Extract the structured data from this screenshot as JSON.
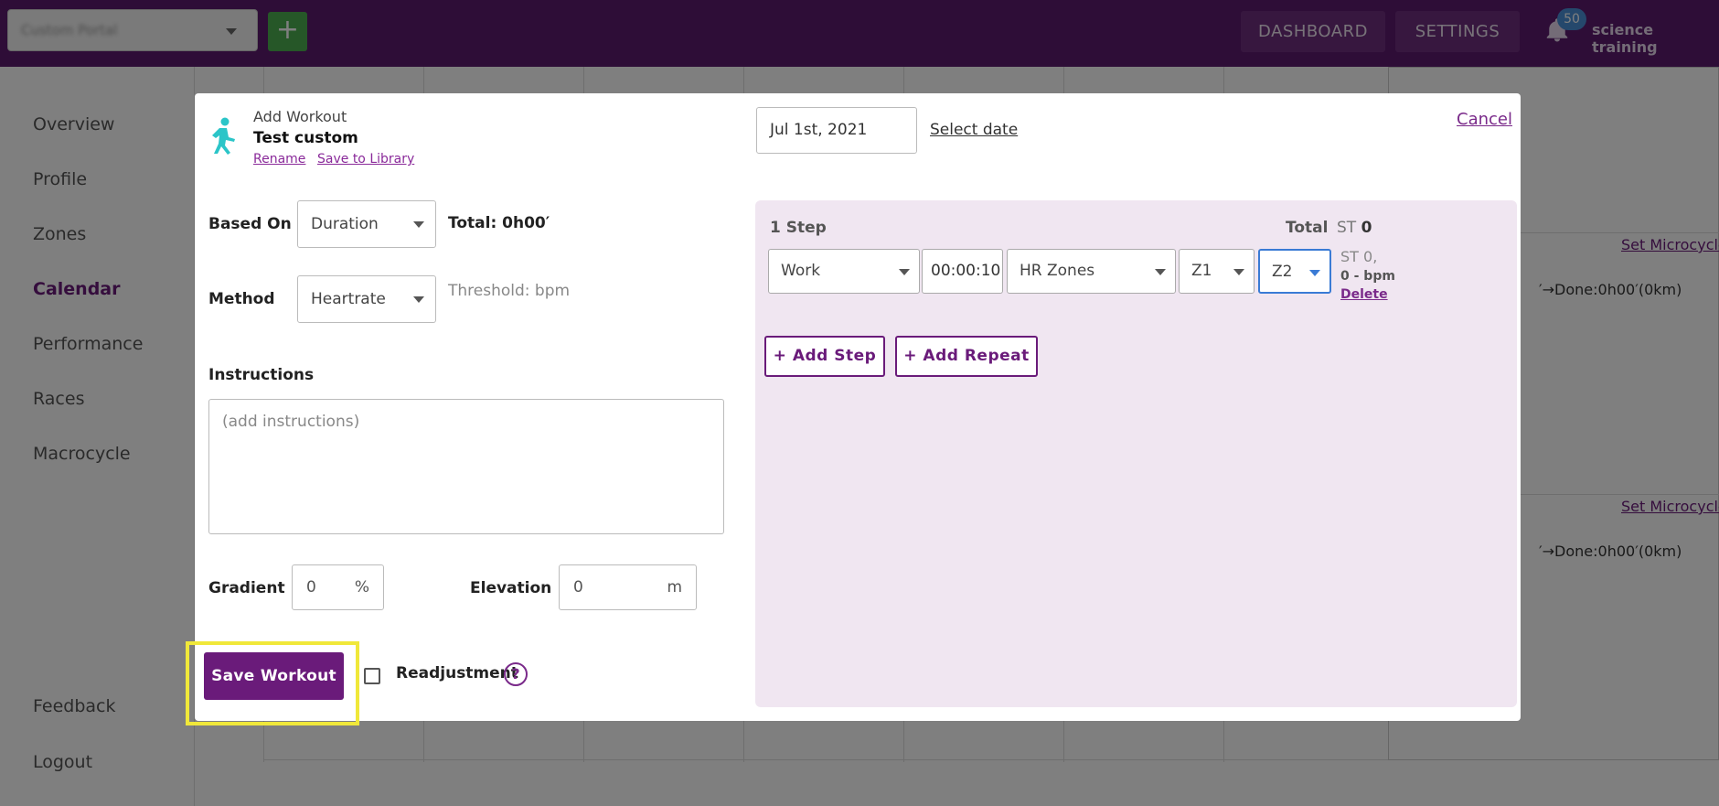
{
  "topbar": {
    "athlete_select_value": "Custom Portal",
    "add_label": "+",
    "dashboard_label": "DASHBOARD",
    "settings_label": "SETTINGS",
    "notifications_count": "50",
    "user_name": "science training"
  },
  "sidebar": {
    "items": [
      {
        "label": "Overview"
      },
      {
        "label": "Profile"
      },
      {
        "label": "Zones"
      },
      {
        "label": "Calendar",
        "active": true
      },
      {
        "label": "Performance"
      },
      {
        "label": "Races"
      },
      {
        "label": "Macrocycle"
      }
    ],
    "feedback_label": "Feedback",
    "logout_label": "Logout"
  },
  "calendar": {
    "microcycle_links": [
      "Set Microcycle",
      "Set Microcycle"
    ],
    "done_texts": [
      "′→Done:0h00′(0km)",
      "′→Done:0h00′(0km)"
    ]
  },
  "modal": {
    "eyebrow": "Add Workout",
    "title": "Test custom",
    "rename_label": "Rename",
    "save_to_library_label": "Save to Library",
    "date_value": "Jul 1st, 2021",
    "select_date_label": "Select date",
    "cancel_label": "Cancel",
    "based_on_label": "Based On",
    "based_on_value": "Duration",
    "total_label": "Total: 0h00′",
    "method_label": "Method",
    "method_value": "Heartrate",
    "threshold_text": "Threshold: bpm",
    "instructions_label": "Instructions",
    "instructions_placeholder": "(add instructions)",
    "gradient_label": "Gradient",
    "gradient_value": "0",
    "gradient_unit": "%",
    "elevation_label": "Elevation",
    "elevation_value": "0",
    "elevation_unit": "m",
    "save_label": "Save Workout",
    "readjustment_label": "Readjustment",
    "help_glyph": "?"
  },
  "steps": {
    "count_label": "1 Step",
    "total_label": "Total",
    "st_label": "ST",
    "st_value": "0",
    "step": {
      "type": "Work",
      "duration": "00:00:10",
      "zone_type": "HR Zones",
      "zone_from": "Z1",
      "zone_to": "Z2",
      "st_text": "ST 0,",
      "bpm_text": "0 - bpm",
      "delete_label": "Delete"
    },
    "add_step_label": "+ Add Step",
    "add_repeat_label": "+ Add Repeat"
  },
  "colors": {
    "brand": "#5c1a6e",
    "accent": "#6a1b7a",
    "highlight": "#f0e83a",
    "focus": "#3a7bd5"
  }
}
